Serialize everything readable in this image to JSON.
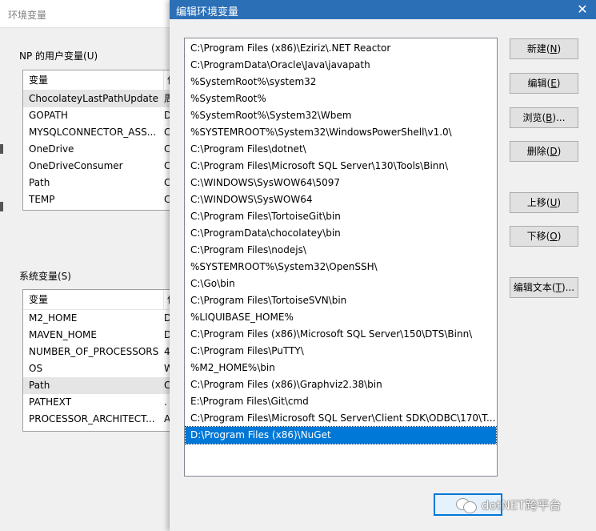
{
  "background_window": {
    "title": "环境变量",
    "user_group_label": "NP 的用户变量(U)",
    "user_columns": [
      "变量",
      "值"
    ],
    "user_vars": [
      {
        "name": "ChocolateyLastPathUpdate",
        "value": "周"
      },
      {
        "name": "GOPATH",
        "value": "D"
      },
      {
        "name": "MYSQLCONNECTOR_ASS...",
        "value": "C"
      },
      {
        "name": "OneDrive",
        "value": "C"
      },
      {
        "name": "OneDriveConsumer",
        "value": "C"
      },
      {
        "name": "Path",
        "value": "C"
      },
      {
        "name": "TEMP",
        "value": "C"
      }
    ],
    "system_group_label": "系统变量(S)",
    "system_columns": [
      "变量",
      "值"
    ],
    "system_vars": [
      {
        "name": "M2_HOME",
        "value": "D"
      },
      {
        "name": "MAVEN_HOME",
        "value": "D"
      },
      {
        "name": "NUMBER_OF_PROCESSORS",
        "value": "4"
      },
      {
        "name": "OS",
        "value": "W"
      },
      {
        "name": "Path",
        "value": "C"
      },
      {
        "name": "PATHEXT",
        "value": "."
      },
      {
        "name": "PROCESSOR_ARCHITECT...",
        "value": "A"
      }
    ]
  },
  "dialog": {
    "title": "编辑环境变量",
    "close_label": "✕",
    "paths": [
      "C:\\Program Files (x86)\\Eziriz\\.NET Reactor",
      "C:\\ProgramData\\Oracle\\Java\\javapath",
      "%SystemRoot%\\system32",
      "%SystemRoot%",
      "%SystemRoot%\\System32\\Wbem",
      "%SYSTEMROOT%\\System32\\WindowsPowerShell\\v1.0\\",
      "C:\\Program Files\\dotnet\\",
      "C:\\Program Files\\Microsoft SQL Server\\130\\Tools\\Binn\\",
      "C:\\WINDOWS\\SysWOW64\\5097",
      "C:\\WINDOWS\\SysWOW64",
      "C:\\Program Files\\TortoiseGit\\bin",
      "C:\\ProgramData\\chocolatey\\bin",
      "C:\\Program Files\\nodejs\\",
      "%SYSTEMROOT%\\System32\\OpenSSH\\",
      "C:\\Go\\bin",
      "C:\\Program Files\\TortoiseSVN\\bin",
      "%LIQUIBASE_HOME%",
      "C:\\Program Files (x86)\\Microsoft SQL Server\\150\\DTS\\Binn\\",
      "C:\\Program Files\\PuTTY\\",
      "%M2_HOME%\\bin",
      "C:\\Program Files (x86)\\Graphviz2.38\\bin",
      "E:\\Program Files\\Git\\cmd",
      "C:\\Program Files\\Microsoft SQL Server\\Client SDK\\ODBC\\170\\T...",
      "D:\\Program Files (x86)\\NuGet"
    ],
    "selected_index": 23,
    "buttons": {
      "new": {
        "text": "新建(",
        "key": "N",
        "tail": ")"
      },
      "edit": {
        "text": "编辑(",
        "key": "E",
        "tail": ")"
      },
      "browse": {
        "text": "浏览(",
        "key": "B",
        "tail": ")..."
      },
      "delete": {
        "text": "删除(",
        "key": "D",
        "tail": ")"
      },
      "move_up": {
        "text": "上移(",
        "key": "U",
        "tail": ")"
      },
      "move_down": {
        "text": "下移(",
        "key": "O",
        "tail": ")"
      },
      "edit_text": {
        "text": "编辑文本(",
        "key": "T",
        "tail": ")..."
      }
    }
  },
  "watermark": "dotNET跨平台",
  "colors": {
    "titlebar": "#2b6fb6",
    "selection": "#0078d7"
  }
}
